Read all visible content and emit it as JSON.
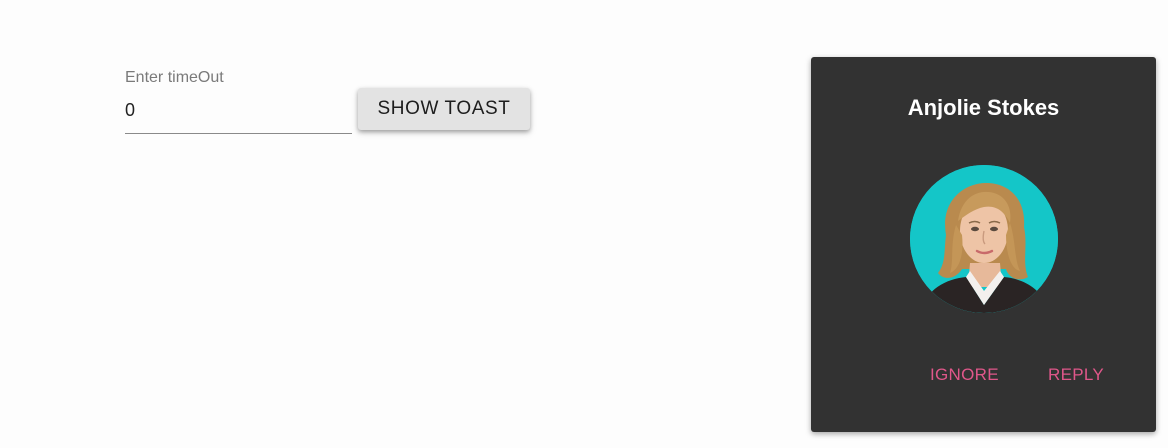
{
  "form": {
    "timeout_label": "Enter timeOut",
    "timeout_value": "0",
    "show_toast_label": "SHOW TOAST"
  },
  "toast": {
    "name": "Anjolie Stokes",
    "avatar_alt": "Anjolie Stokes",
    "ignore_label": "IGNORE",
    "reply_label": "REPLY"
  },
  "colors": {
    "toast_background": "#323232",
    "action_color": "#e0578a",
    "avatar_background": "#15c9c9",
    "button_background": "#e3e3e3"
  }
}
